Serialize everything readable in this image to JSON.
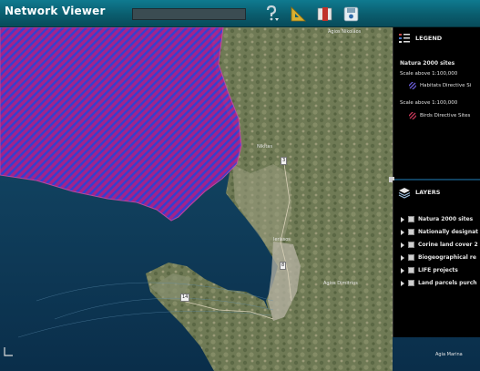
{
  "app": {
    "title": "Network Viewer"
  },
  "toolbar": {
    "search_value": "",
    "tools": [
      "help-icon",
      "measure-icon",
      "print-icon",
      "save-icon"
    ]
  },
  "map": {
    "places": [
      "Agios Nikolaos",
      "Nikitas",
      "Ierissos",
      "Agios Dimitrios",
      "Agia Marina"
    ],
    "road_badges": [
      "3",
      "8",
      "14"
    ],
    "overlay_color": "#b0208f",
    "overlay_hatch_color": "#3a3fd8"
  },
  "legend": {
    "title": "LEGEND",
    "section": "Natura 2000 sites",
    "scale_1": "Scale above 1:100,000",
    "item_1": "Habitats Directive Si",
    "scale_2": "Scale above 1:100,000",
    "item_2": "Birds Directive Sites"
  },
  "layers": {
    "title": "LAYERS",
    "items": [
      "Natura 2000 sites",
      "Nationally designat",
      "Corine land cover 2",
      "Biogeographical re",
      "LIFE projects",
      "Land parcels purch"
    ]
  },
  "colors": {
    "toolbar": "#0a5d6e",
    "panel_bg": "#000000",
    "sea": "#0e3b5c"
  }
}
